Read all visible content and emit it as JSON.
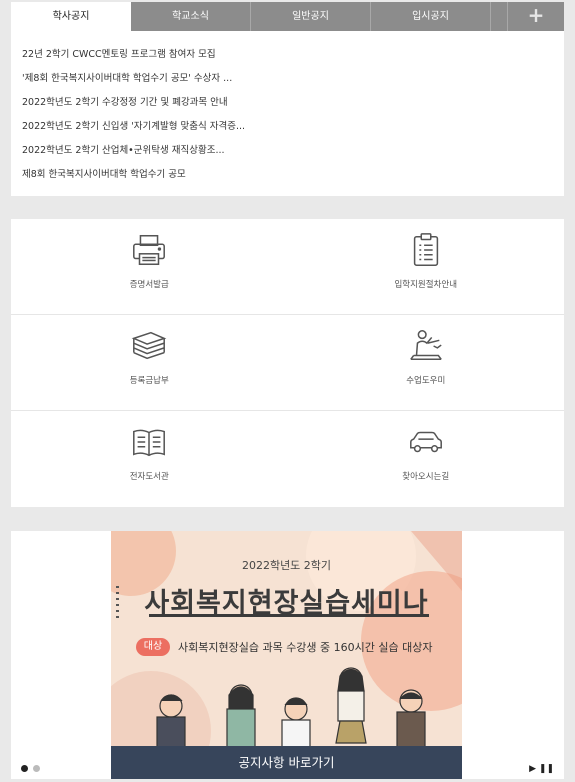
{
  "notice": {
    "tabs": [
      {
        "label": "학사공지"
      },
      {
        "label": "학교소식"
      },
      {
        "label": "일반공지"
      },
      {
        "label": "입시공지"
      }
    ],
    "more_label": "+",
    "items": [
      "22년 2학기 CWCC멘토링 프로그램 참여자 모집",
      "'제8회 한국복지사이버대학 학업수기 공모' 수상자 ...",
      "2022학년도 2학기 수강정정 기간 및 폐강과목 안내",
      "2022학년도 2학기 신입생 '자기계발형 맞춤식 자격증...",
      "2022학년도 2학기 산업체•군위탁생 재직상황조...",
      "제8회 한국복지사이버대학 학업수기 공모"
    ]
  },
  "quick_menu": {
    "items": [
      {
        "label": "증명서발급",
        "icon": "printer-icon"
      },
      {
        "label": "입학지원절차안내",
        "icon": "clipboard-icon"
      },
      {
        "label": "등록금납부",
        "icon": "stack-icon"
      },
      {
        "label": "수업도우미",
        "icon": "teacher-icon"
      },
      {
        "label": "전자도서관",
        "icon": "book-icon"
      },
      {
        "label": "찾아오시는길",
        "icon": "car-icon"
      }
    ]
  },
  "banner": {
    "subtitle": "2022학년도 2학기",
    "title": "사회복지현장실습세미나",
    "badge": "대상",
    "target": "사회복지현장실습 과목 수강생 중 160시간 실습 대상자",
    "button": "공지사항 바로가기",
    "play_label": "▶ ❚❚",
    "active_slide": 1,
    "slide_count": 2
  },
  "colors": {
    "tab_bg": "#8c8c8c",
    "banner_bar": "#37455b",
    "badge": "#ec6f61",
    "poster_bg": "#f6e2d3"
  }
}
